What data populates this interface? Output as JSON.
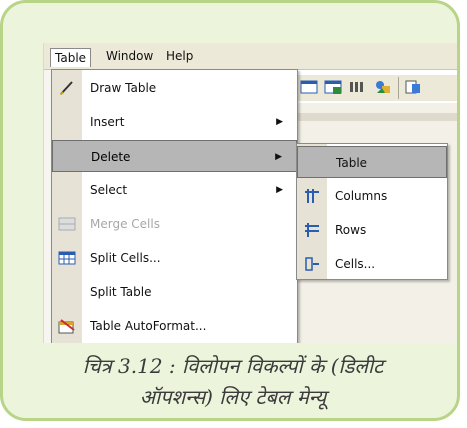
{
  "menubar": {
    "items": [
      "Table",
      "Window",
      "Help"
    ]
  },
  "table_menu": {
    "items": [
      {
        "label": "Draw Table",
        "icon": "pencil-icon",
        "arrow": "",
        "disabled": false,
        "highlight": false
      },
      {
        "label": "Insert",
        "icon": "",
        "arrow": "▶",
        "disabled": false,
        "highlight": false
      },
      {
        "label": "Delete",
        "icon": "",
        "arrow": "▶",
        "disabled": false,
        "highlight": true
      },
      {
        "label": "Select",
        "icon": "",
        "arrow": "▶",
        "disabled": false,
        "highlight": false
      },
      {
        "label": "Merge Cells",
        "icon": "merge-cells-icon",
        "arrow": "",
        "disabled": true,
        "highlight": false
      },
      {
        "label": "Split Cells...",
        "icon": "split-cells-icon",
        "arrow": "",
        "disabled": false,
        "highlight": false
      },
      {
        "label": "Split Table",
        "icon": "",
        "arrow": "",
        "disabled": false,
        "highlight": false
      },
      {
        "label": "Table AutoFormat...",
        "icon": "table-autoformat-icon",
        "arrow": "",
        "disabled": false,
        "highlight": false
      }
    ]
  },
  "delete_submenu": {
    "items": [
      {
        "label": "Table",
        "icon": "",
        "highlight": true
      },
      {
        "label": "Columns",
        "icon": "delete-columns-icon",
        "highlight": false
      },
      {
        "label": "Rows",
        "icon": "delete-rows-icon",
        "highlight": false
      },
      {
        "label": "Cells...",
        "icon": "delete-cells-icon",
        "highlight": false
      }
    ]
  },
  "caption": {
    "line1": "चित्र 3.12 : विलोपन विकल्पों के (डिलीट",
    "line2": "ऑपशन्स) लिए टेबल मेन्यू"
  },
  "colors": {
    "card_bg": "#ecf5dc",
    "card_border": "#b8d487",
    "highlight": "#b6b6b6"
  }
}
